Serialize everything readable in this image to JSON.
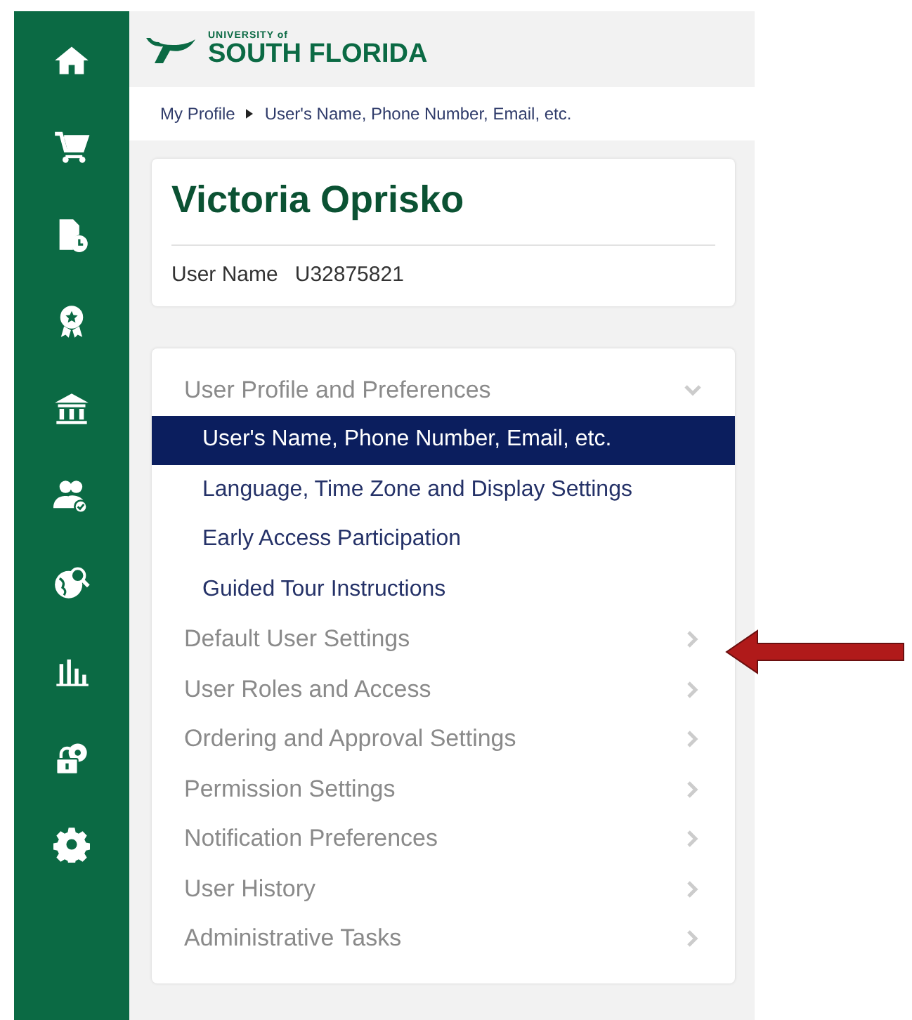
{
  "logo": {
    "top": "UNIVERSITY of",
    "name": "SOUTH FLORIDA"
  },
  "breadcrumb": {
    "items": [
      "My Profile",
      "User's Name, Phone Number, Email, etc."
    ]
  },
  "profile": {
    "name": "Victoria Oprisko",
    "field_label": "User Name",
    "field_value": "U32875821"
  },
  "menu": [
    {
      "label": "User Profile and Preferences",
      "expanded": true,
      "children": [
        {
          "label": "User's Name, Phone Number, Email, etc.",
          "selected": true
        },
        {
          "label": "Language, Time Zone and Display Settings",
          "selected": false
        },
        {
          "label": "Early Access Participation",
          "selected": false
        },
        {
          "label": "Guided Tour Instructions",
          "selected": false
        }
      ]
    },
    {
      "label": "Default User Settings",
      "expanded": false
    },
    {
      "label": "User Roles and Access",
      "expanded": false
    },
    {
      "label": "Ordering and Approval Settings",
      "expanded": false
    },
    {
      "label": "Permission Settings",
      "expanded": false
    },
    {
      "label": "Notification Preferences",
      "expanded": false
    },
    {
      "label": "User History",
      "expanded": false
    },
    {
      "label": "Administrative Tasks",
      "expanded": false
    }
  ]
}
